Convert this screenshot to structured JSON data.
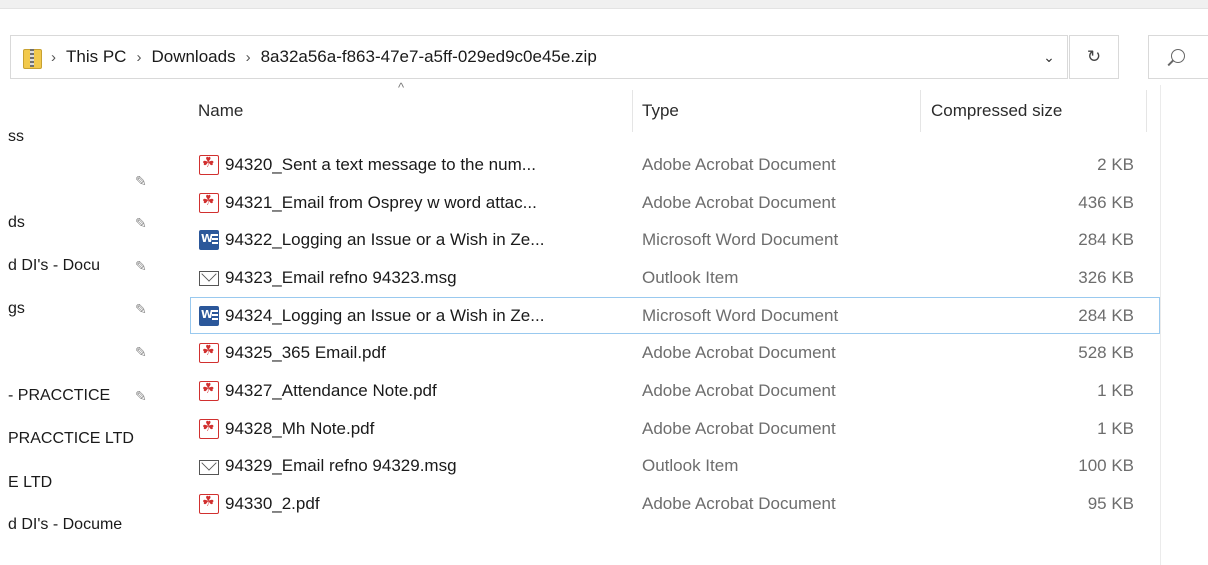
{
  "address": {
    "crumbs": [
      "This PC",
      "Downloads",
      "8a32a56a-f863-47e7-a5ff-029ed9c0e45e.zip"
    ],
    "separator": "›",
    "dropdown_icon": "chevron-down-icon",
    "dropdown_glyph": "⌄",
    "refresh_icon": "refresh-icon",
    "refresh_glyph": "↻"
  },
  "nav": {
    "items": [
      {
        "label": "ss",
        "pinned": false
      },
      {
        "label": "",
        "pinned": true
      },
      {
        "label": "ds",
        "pinned": true
      },
      {
        "label": "d DI's - Docu",
        "pinned": true
      },
      {
        "label": "gs",
        "pinned": true
      },
      {
        "label": "",
        "pinned": true
      },
      {
        "label": "- PRACCTICE",
        "pinned": true
      },
      {
        "label": "PRACCTICE LTD",
        "pinned": false
      },
      {
        "label": "E LTD",
        "pinned": false
      },
      {
        "label": "d DI's - Docume",
        "pinned": false
      }
    ],
    "pin_glyph": "✎"
  },
  "columns": {
    "name": "Name",
    "type": "Type",
    "compressed_size": "Compressed size",
    "sort_glyph": "^"
  },
  "files": [
    {
      "name": "94320_Sent a text message to the num...",
      "type": "Adobe Acrobat Document",
      "size": "2 KB",
      "icon": "pdf"
    },
    {
      "name": "94321_Email from Osprey w word attac...",
      "type": "Adobe Acrobat Document",
      "size": "436 KB",
      "icon": "pdf"
    },
    {
      "name": "94322_Logging an Issue or a Wish in Ze...",
      "type": "Microsoft Word Document",
      "size": "284 KB",
      "icon": "word"
    },
    {
      "name": "94323_Email refno 94323.msg",
      "type": "Outlook Item",
      "size": "326 KB",
      "icon": "mail"
    },
    {
      "name": "94324_Logging an Issue or a Wish in Ze...",
      "type": "Microsoft Word Document",
      "size": "284 KB",
      "icon": "word",
      "focused": true
    },
    {
      "name": "94325_365 Email.pdf",
      "type": "Adobe Acrobat Document",
      "size": "528 KB",
      "icon": "pdf"
    },
    {
      "name": "94327_Attendance Note.pdf",
      "type": "Adobe Acrobat Document",
      "size": "1 KB",
      "icon": "pdf"
    },
    {
      "name": "94328_Mh Note.pdf",
      "type": "Adobe Acrobat Document",
      "size": "1 KB",
      "icon": "pdf"
    },
    {
      "name": "94329_Email refno 94329.msg",
      "type": "Outlook Item",
      "size": "100 KB",
      "icon": "mail"
    },
    {
      "name": "94330_2.pdf",
      "type": "Adobe Acrobat Document",
      "size": "95 KB",
      "icon": "pdf"
    }
  ]
}
